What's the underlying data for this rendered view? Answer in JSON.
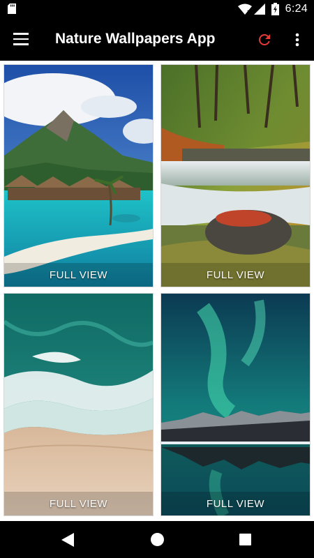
{
  "status_bar": {
    "time": "6:24",
    "icons": [
      "sd-card-icon",
      "wifi-icon",
      "signal-icon",
      "battery-charging-icon"
    ]
  },
  "app_bar": {
    "title": "Nature Wallpapers App",
    "icons": [
      "menu-icon",
      "refresh-icon",
      "more-vert-icon"
    ],
    "accent_color": "#e53935"
  },
  "wallpapers": [
    {
      "scene": "tropical-island-bungalows",
      "label": "FULL VIEW"
    },
    {
      "scene": "forest-waterfall",
      "label": "FULL VIEW"
    },
    {
      "scene": "aerial-beach-waves",
      "label": "FULL VIEW"
    },
    {
      "scene": "aurora-mountains-lake",
      "label": "FULL VIEW"
    }
  ],
  "nav_bar": {
    "icons": [
      "back-icon",
      "home-icon",
      "recents-icon"
    ]
  }
}
